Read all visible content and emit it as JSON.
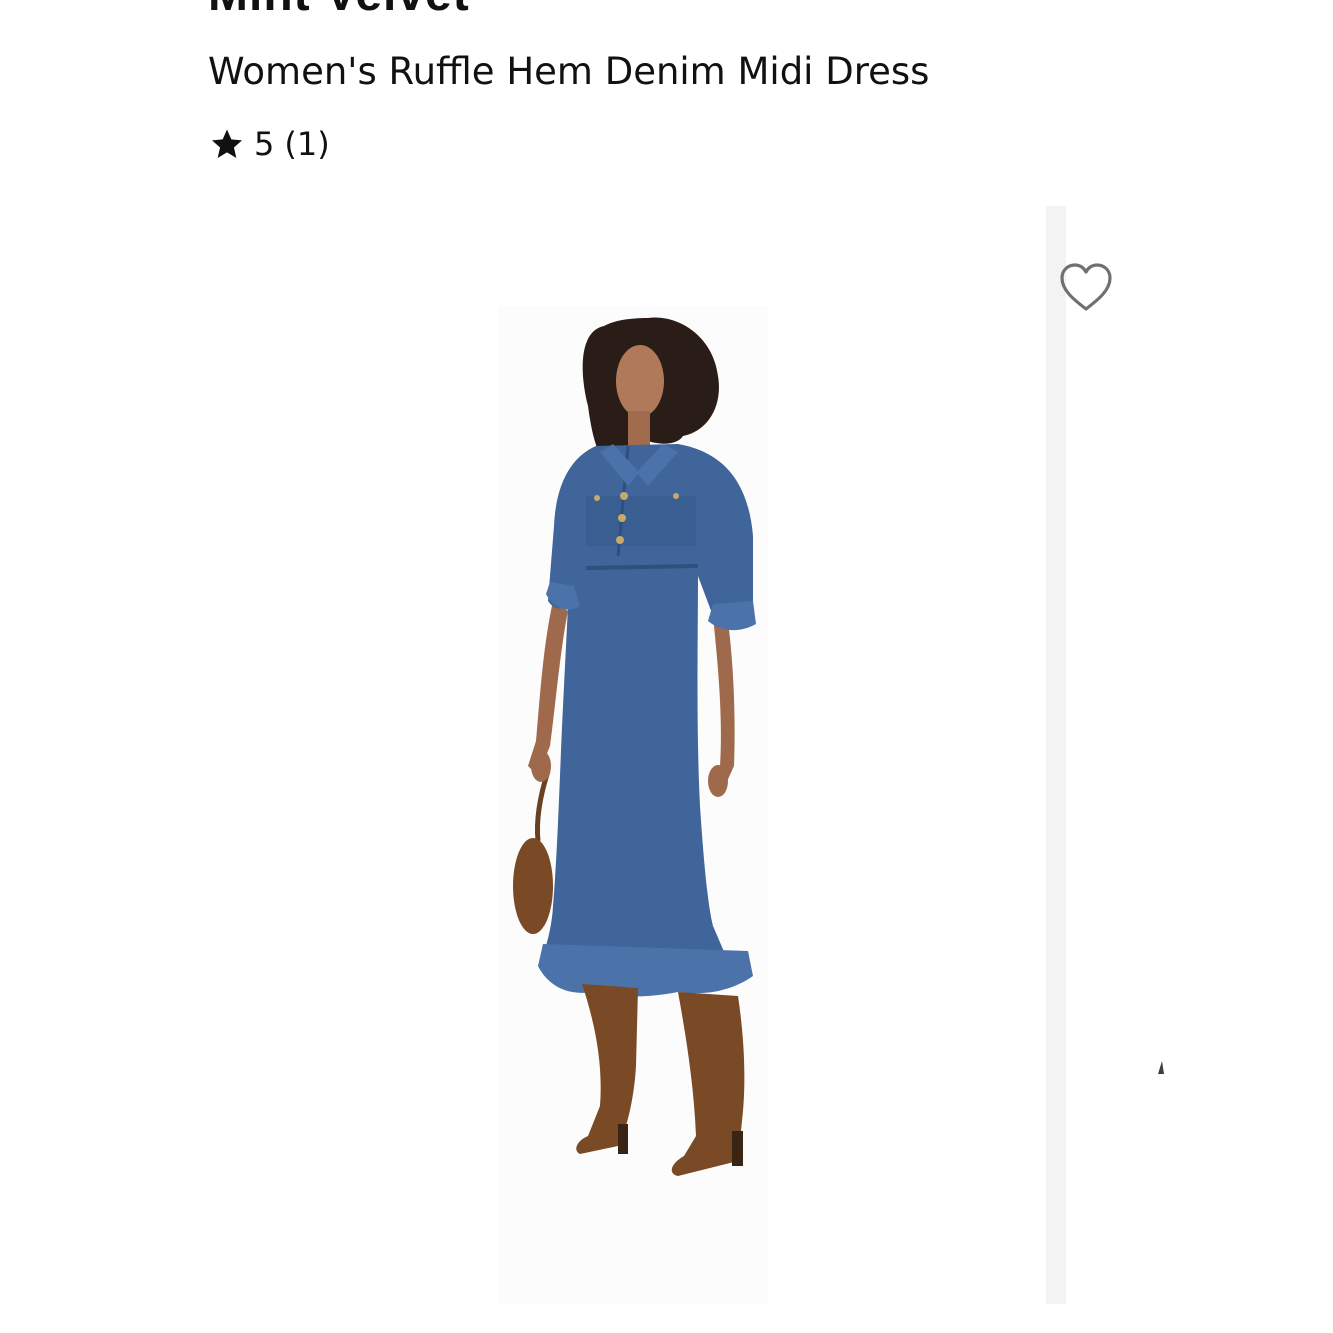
{
  "product": {
    "brand": "Mint Velvet",
    "title": "Women's Ruffle Hem Denim Midi Dress",
    "rating": {
      "value": "5",
      "count": "(1)",
      "stars_filled": 1
    }
  },
  "icons": {
    "rating": "star-icon",
    "favorite": "heart-outline-icon"
  },
  "colors": {
    "text": "#111111",
    "denim": "#3f659a",
    "boots": "#7a4a26",
    "heart_stroke": "#707070"
  }
}
